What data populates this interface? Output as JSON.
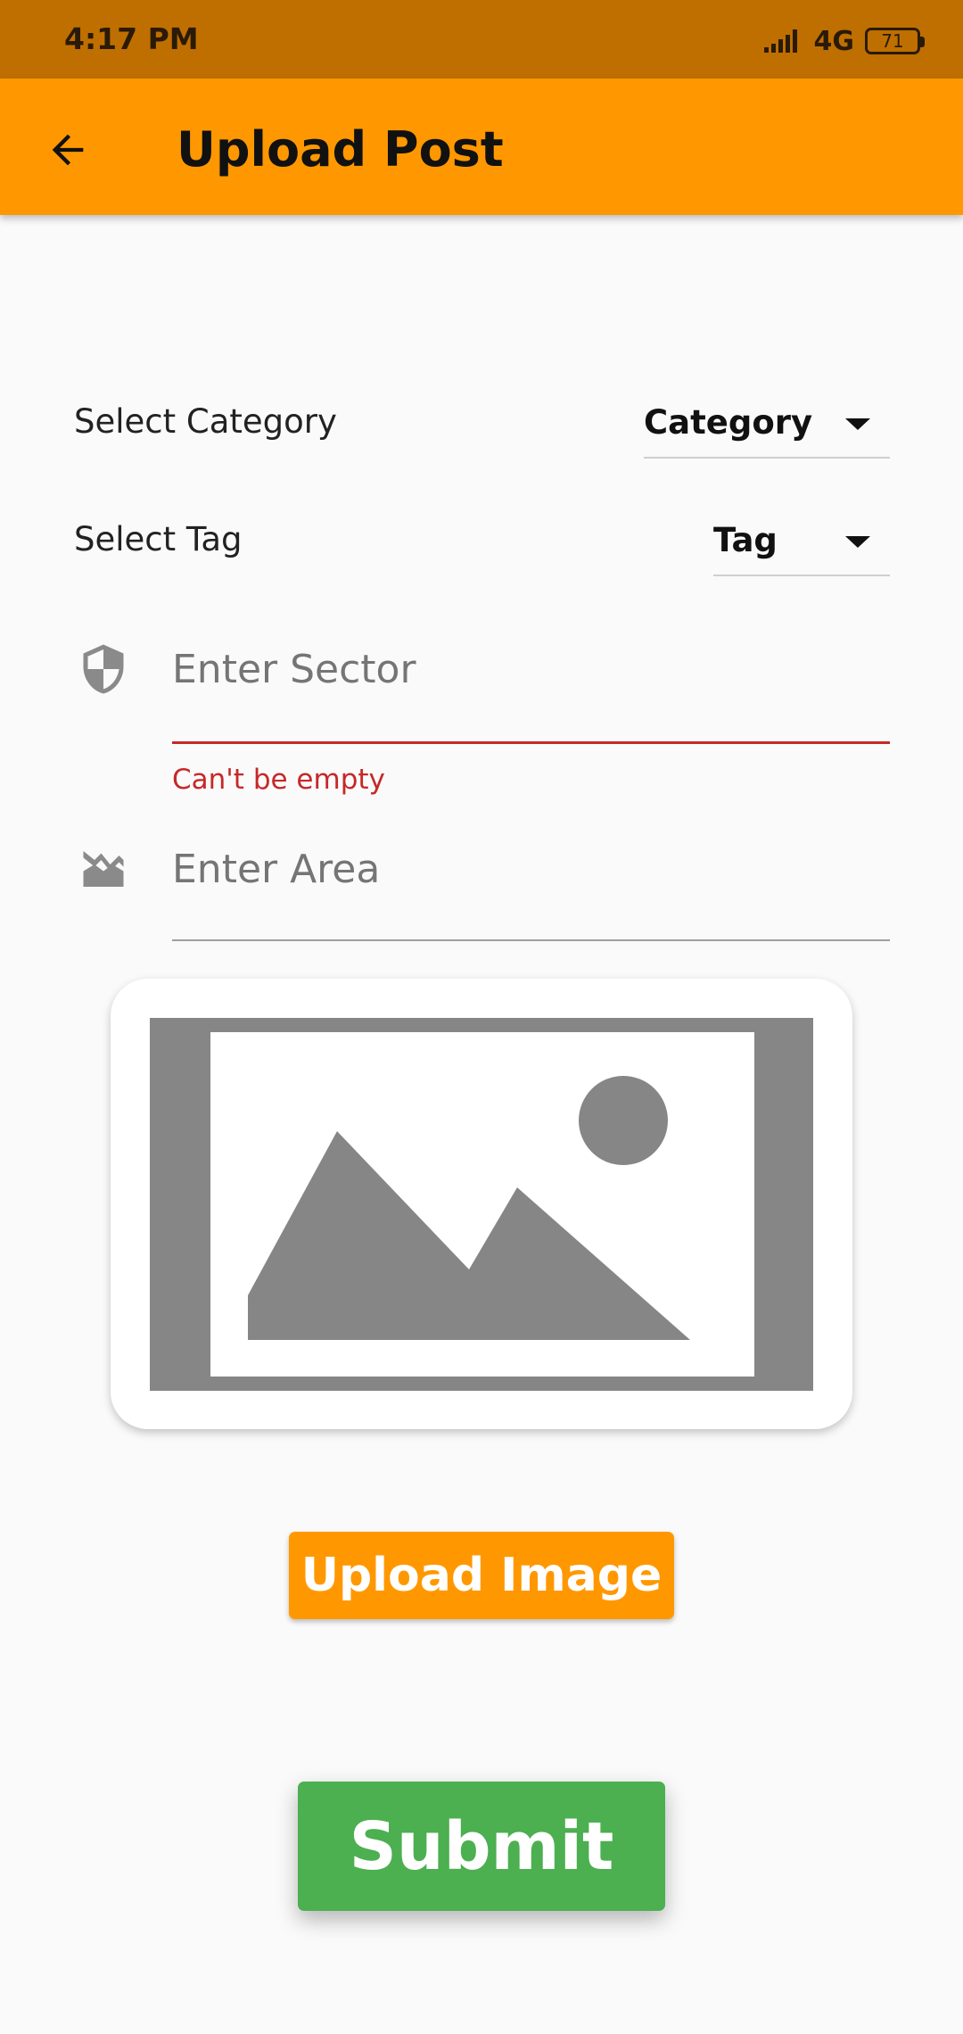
{
  "status_bar": {
    "time": "4:17 PM",
    "network": "4G",
    "battery": "71",
    "icons": [
      "signal-icon",
      "battery-icon"
    ]
  },
  "app_bar": {
    "title": "Upload Post",
    "back_icon": "arrow-back-icon"
  },
  "form": {
    "category": {
      "label": "Select Category",
      "selected": "Category"
    },
    "tag": {
      "label": "Select Tag",
      "selected": "Tag"
    },
    "sector": {
      "placeholder": "Enter Sector",
      "value": "",
      "error": "Can't be empty",
      "icon": "shield-icon"
    },
    "area": {
      "placeholder": "Enter Area",
      "value": "",
      "icon": "landscape-icon"
    }
  },
  "image_preview": {
    "icon": "image-placeholder-icon"
  },
  "buttons": {
    "upload_image": "Upload Image",
    "submit": "Submit"
  },
  "colors": {
    "status_bar": "#bf6f00",
    "app_bar": "#ff9800",
    "error": "#c62828",
    "submit": "#4caf50",
    "upload": "#ff9800"
  }
}
